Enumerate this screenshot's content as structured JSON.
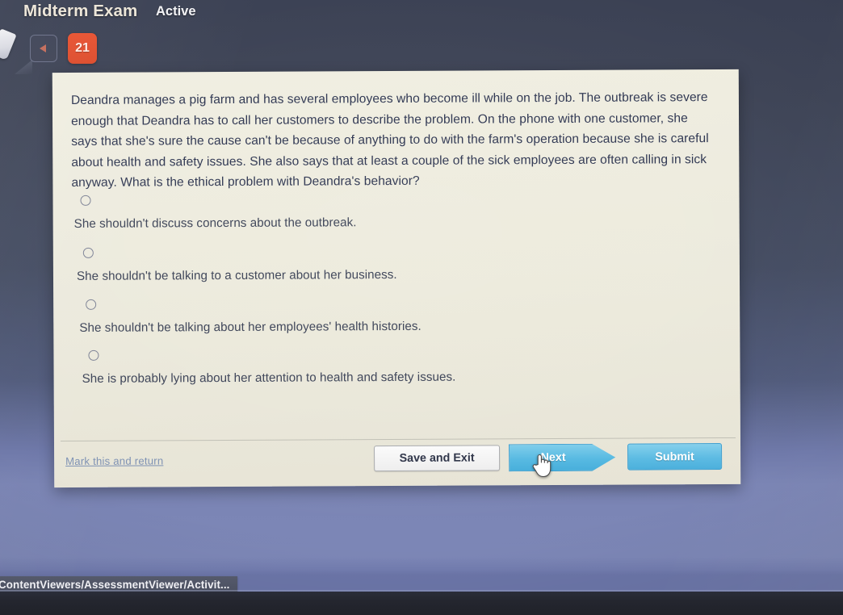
{
  "header": {
    "app_title": "Midterm Exam",
    "status": "Active",
    "back_label": "Back",
    "question_number": "21",
    "badge_color": "#e8512f"
  },
  "question": {
    "text": "Deandra manages a pig farm and has several employees who become ill while on the job. The outbreak is severe enough that Deandra has to call her customers to describe the problem. On the phone with one customer, she says that she's sure the cause can't be because of anything to do with the farm's operation because she is careful about health and safety issues. She also says that at least a couple of the sick employees are often calling in sick anyway. What is the ethical problem with Deandra's behavior?",
    "options": [
      {
        "label": "She shouldn't discuss concerns about the outbreak.",
        "selected": false
      },
      {
        "label": "She shouldn't be talking to a customer about her business.",
        "selected": false
      },
      {
        "label": "She shouldn't be talking about her employees' health histories.",
        "selected": false
      },
      {
        "label": "She is probably lying about her attention to health and safety issues.",
        "selected": false
      }
    ]
  },
  "footer": {
    "mark_return_label": "Mark this and return",
    "save_exit_label": "Save and Exit",
    "next_label": "Next",
    "submit_label": "Submit"
  },
  "statusbar": {
    "url": "ContentViewers/AssessmentViewer/Activit..."
  },
  "colors": {
    "background_top": "#3a4053",
    "background_bottom": "#7d87b7",
    "card": "#eceadc",
    "primary_button": "#56b9e2",
    "link": "#7e92b4"
  }
}
